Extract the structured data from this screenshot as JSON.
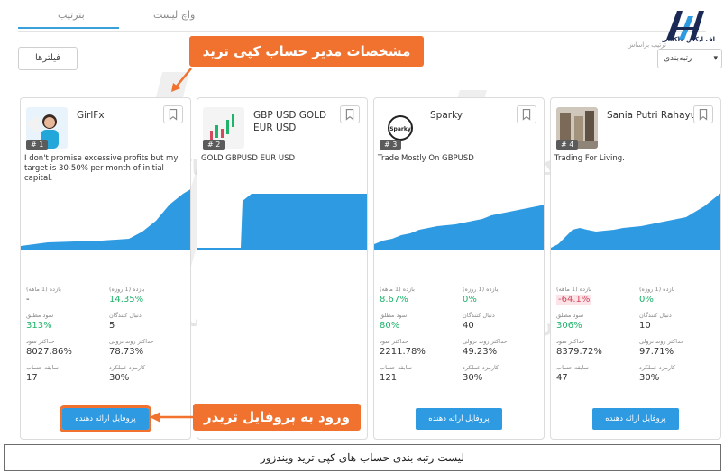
{
  "tabs": [
    {
      "label": "بترتیب",
      "active": true
    },
    {
      "label": "واچ لیست",
      "active": false
    }
  ],
  "filters_label": "فیلترها",
  "sort": {
    "label": "ترتیب براساس",
    "value": "رتبه‌بندی"
  },
  "logo_text": "اف ایکس ماکسی",
  "watermark_text": "اف ایکس ماکسی",
  "callouts": {
    "manager": "مشخصات مدیر حساب کپی ترید",
    "profile": "ورود به پروفایل تریدر"
  },
  "accent_color": "#2d9ae2",
  "callout_color": "#f0722e",
  "cards": [
    {
      "rank": "# 1",
      "name": "GirlFx",
      "description": "I don't promise excessive profits but my target is 30-50% per month of initial capital.",
      "stats": {
        "return_month_label": "بازده (1 ماهه)",
        "return_month": "-",
        "return_day_label": "بازده (1 روزه)",
        "return_day": "14.35%",
        "absolute_profit_label": "سود مطلق",
        "absolute_profit": "313%",
        "followers_label": "دنبال کنندگان",
        "followers": "5",
        "max_profit_label": "حداکثر سود",
        "max_profit": "8027.86%",
        "max_drawdown_label": "حداکثر روند نزولی",
        "max_drawdown": "78.73%",
        "account_age_label": "سابقه حساب",
        "account_age": "17",
        "commission_label": "کارمزد عملکرد",
        "commission": "30%"
      },
      "button": "پروفایل ارائه دهنده"
    },
    {
      "rank": "# 2",
      "name": "GBP USD GOLD EUR USD",
      "description": "GOLD GBPUSD EUR USD",
      "stats": {},
      "button": ""
    },
    {
      "rank": "# 3",
      "name": "Sparky",
      "description": "Trade Mostly On GBPUSD",
      "stats": {
        "return_month_label": "بازده (1 ماهه)",
        "return_month": "8.67%",
        "return_day_label": "بازده (1 روزه)",
        "return_day": "0%",
        "absolute_profit_label": "سود مطلق",
        "absolute_profit": "80%",
        "followers_label": "دنبال کنندگان",
        "followers": "40",
        "max_profit_label": "حداکثر سود",
        "max_profit": "2211.78%",
        "max_drawdown_label": "حداکثر روند نزولی",
        "max_drawdown": "49.23%",
        "account_age_label": "سابقه حساب",
        "account_age": "121",
        "commission_label": "کارمزد عملکرد",
        "commission": "30%"
      },
      "button": "پروفایل ارائه دهنده"
    },
    {
      "rank": "# 4",
      "name": "Sania Putri Rahayu",
      "description": "Trading For Living.",
      "stats": {
        "return_month_label": "بازده (1 ماهه)",
        "return_month": "-64.1%",
        "return_day_label": "بازده (1 روزه)",
        "return_day": "0%",
        "absolute_profit_label": "سود مطلق",
        "absolute_profit": "306%",
        "followers_label": "دنبال کنندگان",
        "followers": "10",
        "max_profit_label": "حداکثر سود",
        "max_profit": "8379.72%",
        "max_drawdown_label": "حداکثر روند نزولی",
        "max_drawdown": "97.71%",
        "account_age_label": "سابقه حساب",
        "account_age": "47",
        "commission_label": "کارمزد عملکرد",
        "commission": "30%"
      },
      "button": "پروفایل ارائه دهنده"
    }
  ],
  "caption": "لیست رتبه بندی حساب های کپی ترید ویندزور"
}
